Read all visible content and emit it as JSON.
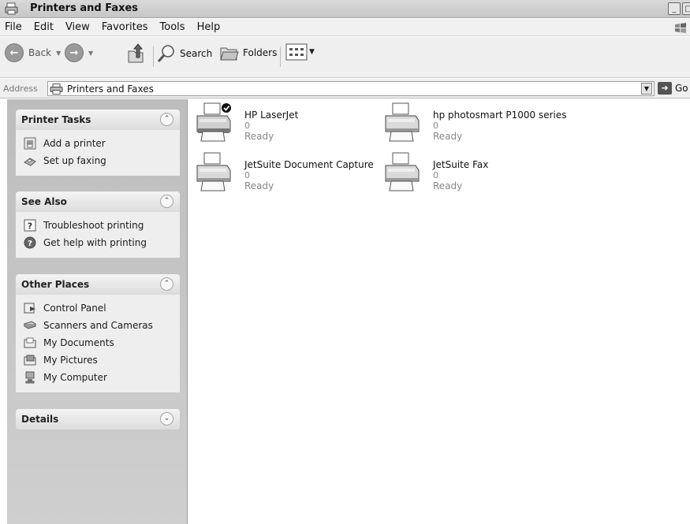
{
  "window": {
    "title": "Printers and Faxes",
    "controls": {
      "minimize": "_",
      "maximize": "□"
    }
  },
  "menu": [
    "File",
    "Edit",
    "View",
    "Favorites",
    "Tools",
    "Help"
  ],
  "toolbar": {
    "back_label": "Back",
    "search_label": "Search",
    "folders_label": "Folders"
  },
  "address": {
    "label": "Address",
    "value": "Printers and Faxes",
    "go_label": "Go"
  },
  "task_pane": {
    "printer_tasks": {
      "title": "Printer Tasks",
      "items": [
        {
          "label": "Add a printer",
          "icon": "add-printer-icon"
        },
        {
          "label": "Set up faxing",
          "icon": "fax-icon"
        }
      ]
    },
    "see_also": {
      "title": "See Also",
      "items": [
        {
          "label": "Troubleshoot printing",
          "icon": "help-icon"
        },
        {
          "label": "Get help with printing",
          "icon": "help-circle-icon"
        }
      ]
    },
    "other_places": {
      "title": "Other Places",
      "items": [
        {
          "label": "Control Panel",
          "icon": "control-panel-icon"
        },
        {
          "label": "Scanners and Cameras",
          "icon": "scanner-icon"
        },
        {
          "label": "My Documents",
          "icon": "folder-icon"
        },
        {
          "label": "My Pictures",
          "icon": "pictures-icon"
        },
        {
          "label": "My Computer",
          "icon": "computer-icon"
        }
      ]
    },
    "details": {
      "title": "Details"
    }
  },
  "printers": [
    {
      "name": "HP LaserJet",
      "jobs": "0",
      "status": "Ready",
      "is_default": true
    },
    {
      "name": "hp photosmart P1000 series",
      "jobs": "0",
      "status": "Ready",
      "is_default": false
    },
    {
      "name": "JetSuite Document Capture",
      "jobs": "0",
      "status": "Ready",
      "is_default": false
    },
    {
      "name": "JetSuite Fax",
      "jobs": "0",
      "status": "Ready",
      "is_default": false
    }
  ]
}
